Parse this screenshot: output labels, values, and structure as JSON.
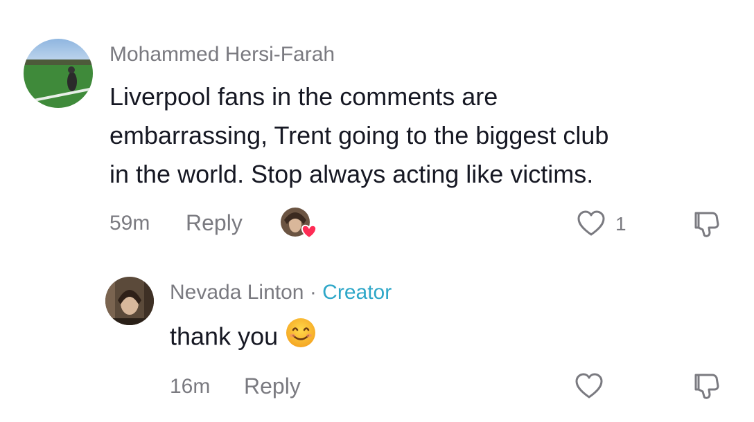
{
  "comments": [
    {
      "username": "Mohammed Hersi-Farah",
      "text_lines": [
        "Liverpool fans in the comments are",
        "embarrassing, Trent going to the biggest club",
        "in the world. Stop always acting like victims."
      ],
      "time": "59m",
      "reply_label": "Reply",
      "like_count": "1",
      "icons": {
        "avatar": "avatar-photo",
        "liked_by": "creator-liked-heart-avatar",
        "like": "heart-outline-icon",
        "dislike": "thumbs-down-icon"
      }
    },
    {
      "username": "Nevada Linton",
      "separator": "·",
      "badge": "Creator",
      "text": "thank you",
      "emoji": "smiling-face-emoji",
      "time": "16m",
      "reply_label": "Reply",
      "icons": {
        "avatar": "avatar-photo",
        "like": "heart-outline-icon",
        "dislike": "thumbs-down-icon"
      }
    }
  ],
  "colors": {
    "text": "#161823",
    "muted": "#7a7a80",
    "creator": "#2ea7c8",
    "liked_heart": "#fe2c55"
  }
}
